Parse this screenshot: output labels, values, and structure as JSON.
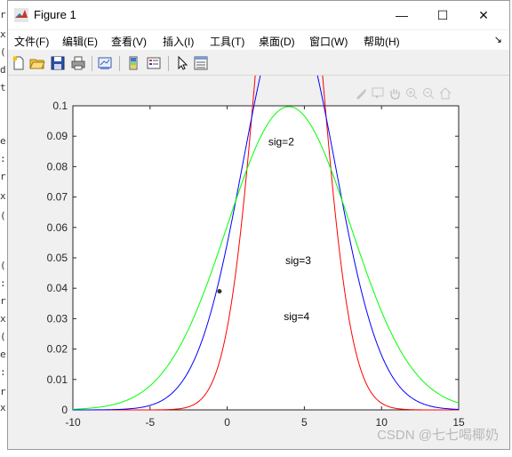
{
  "window": {
    "title": "Figure 1"
  },
  "window_controls": {
    "minimize": "—",
    "maximize": "☐",
    "close": "✕"
  },
  "background_text": [
    "r",
    "x",
    "(",
    "d",
    "t",
    "e",
    ":",
    "r",
    "x",
    "(",
    "(",
    ":",
    "r",
    "x",
    "(",
    "e",
    ":",
    "r",
    "x",
    "("
  ],
  "menubar": {
    "items": [
      "文件(F)",
      "编辑(E)",
      "查看(V)",
      "插入(I)",
      "工具(T)",
      "桌面(D)",
      "窗口(W)",
      "帮助(H)"
    ],
    "overflow_arrow": "↘"
  },
  "toolbar": {
    "icons": [
      "new-figure-icon",
      "open-file-icon",
      "save-icon",
      "print-icon",
      "link-plot-icon",
      "insert-colorbar-icon",
      "insert-legend-icon",
      "edit-plot-icon",
      "property-inspector-icon"
    ]
  },
  "axes_toolbar": {
    "icons": [
      "brush-icon",
      "datatip-icon",
      "pan-icon",
      "zoom-in-icon",
      "zoom-out-icon",
      "home-icon"
    ]
  },
  "watermark": "CSDN @七七喝椰奶",
  "chart_data": {
    "type": "line",
    "title": "",
    "xlabel": "",
    "ylabel": "",
    "xlim": [
      -10,
      15
    ],
    "ylim": [
      0,
      0.1
    ],
    "x_ticks": [
      -10,
      -5,
      0,
      5,
      10,
      15
    ],
    "y_ticks": [
      0,
      0.01,
      0.02,
      0.03,
      0.04,
      0.05,
      0.06,
      0.07,
      0.08,
      0.09,
      0.1
    ],
    "x_tick_labels": [
      "-10",
      "-5",
      "0",
      "5",
      "10",
      "15"
    ],
    "y_tick_labels": [
      "0",
      "0.01",
      "0.02",
      "0.03",
      "0.04",
      "0.05",
      "0.06",
      "0.07",
      "0.08",
      "0.09",
      "0.1"
    ],
    "grid": false,
    "box": true,
    "series": [
      {
        "mu": 4,
        "sigma": 2,
        "color": "#ff0000",
        "annotation": "sig=2",
        "label_at": [
          3.5,
          0.087
        ]
      },
      {
        "mu": 4,
        "sigma": 3,
        "color": "#0000ff",
        "annotation": "sig=3",
        "label_at": [
          4.6,
          0.048
        ]
      },
      {
        "mu": 4,
        "sigma": 4,
        "color": "#00ff00",
        "annotation": "sig=4",
        "label_at": [
          4.5,
          0.0295
        ]
      }
    ],
    "marker": {
      "x": -0.5,
      "y": 0.039,
      "color": "#333333"
    }
  }
}
